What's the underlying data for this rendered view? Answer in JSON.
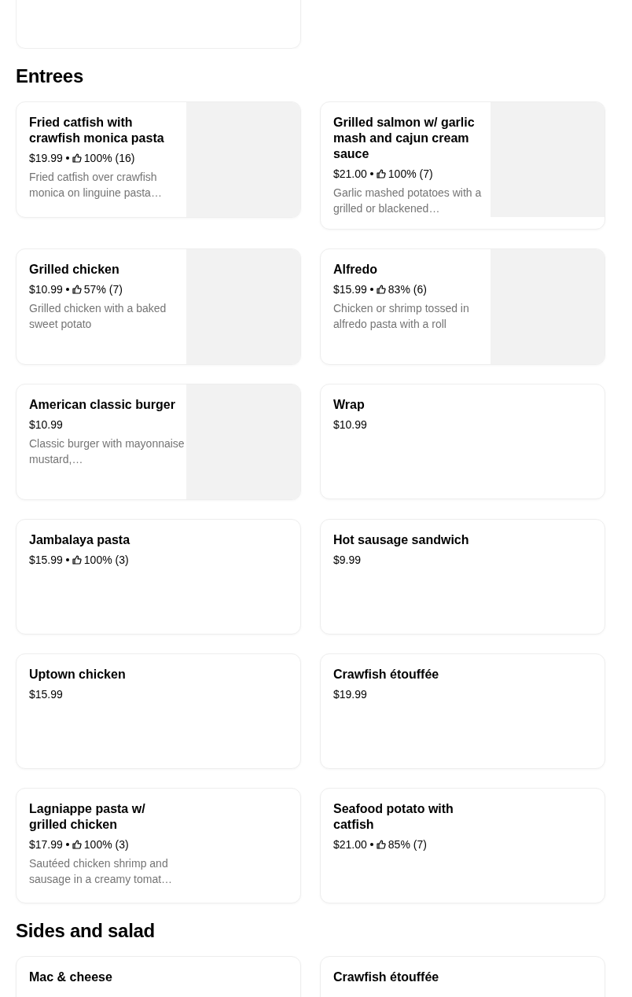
{
  "sections": [
    {
      "title": "Entrees",
      "items": [
        {
          "name": "Fried catfish with crawfish monica pasta",
          "price": "$19.99",
          "rating": "100% (16)",
          "description": "Fried catfish over crawfish monica on linguine pasta…",
          "has_image": true
        },
        {
          "name": "Grilled salmon w/ garlic mash and cajun cream sauce",
          "price": "$21.00",
          "rating": "100% (7)",
          "description": "Garlic mashed potatoes with a grilled or blackened…",
          "has_image": true
        },
        {
          "name": "Grilled chicken",
          "price": "$10.99",
          "rating": "57% (7)",
          "description": "Grilled chicken with a baked sweet potato",
          "has_image": true
        },
        {
          "name": "Alfredo",
          "price": "$15.99",
          "rating": "83% (6)",
          "description": "Chicken or shrimp tossed in alfredo pasta with a roll",
          "has_image": true
        },
        {
          "name": "American classic burger",
          "price": "$10.99",
          "description": "Classic burger with mayonnaise mustard,…",
          "has_image": true
        },
        {
          "name": "Wrap",
          "price": "$10.99",
          "has_image": false
        },
        {
          "name": "Jambalaya pasta",
          "price": "$15.99",
          "rating": "100% (3)",
          "has_image": false
        },
        {
          "name": "Hot sausage sandwich",
          "price": "$9.99",
          "has_image": false
        },
        {
          "name": "Uptown chicken",
          "price": "$15.99",
          "has_image": false
        },
        {
          "name": "Crawfish étouffée",
          "price": "$19.99",
          "has_image": false
        },
        {
          "name": "Lagniappe pasta w/ grilled chicken",
          "price": "$17.99",
          "rating": "100% (3)",
          "description": "Sautéed chicken shrimp and sausage in a creamy tomat…",
          "has_image": false
        },
        {
          "name": "Seafood potato with catfish",
          "price": "$21.00",
          "rating": "85% (7)",
          "has_image": false
        }
      ]
    },
    {
      "title": "Sides and salad",
      "items": [
        {
          "name": "Mac & cheese",
          "has_image": false
        },
        {
          "name": "Crawfish étouffée",
          "has_image": false
        }
      ]
    }
  ]
}
